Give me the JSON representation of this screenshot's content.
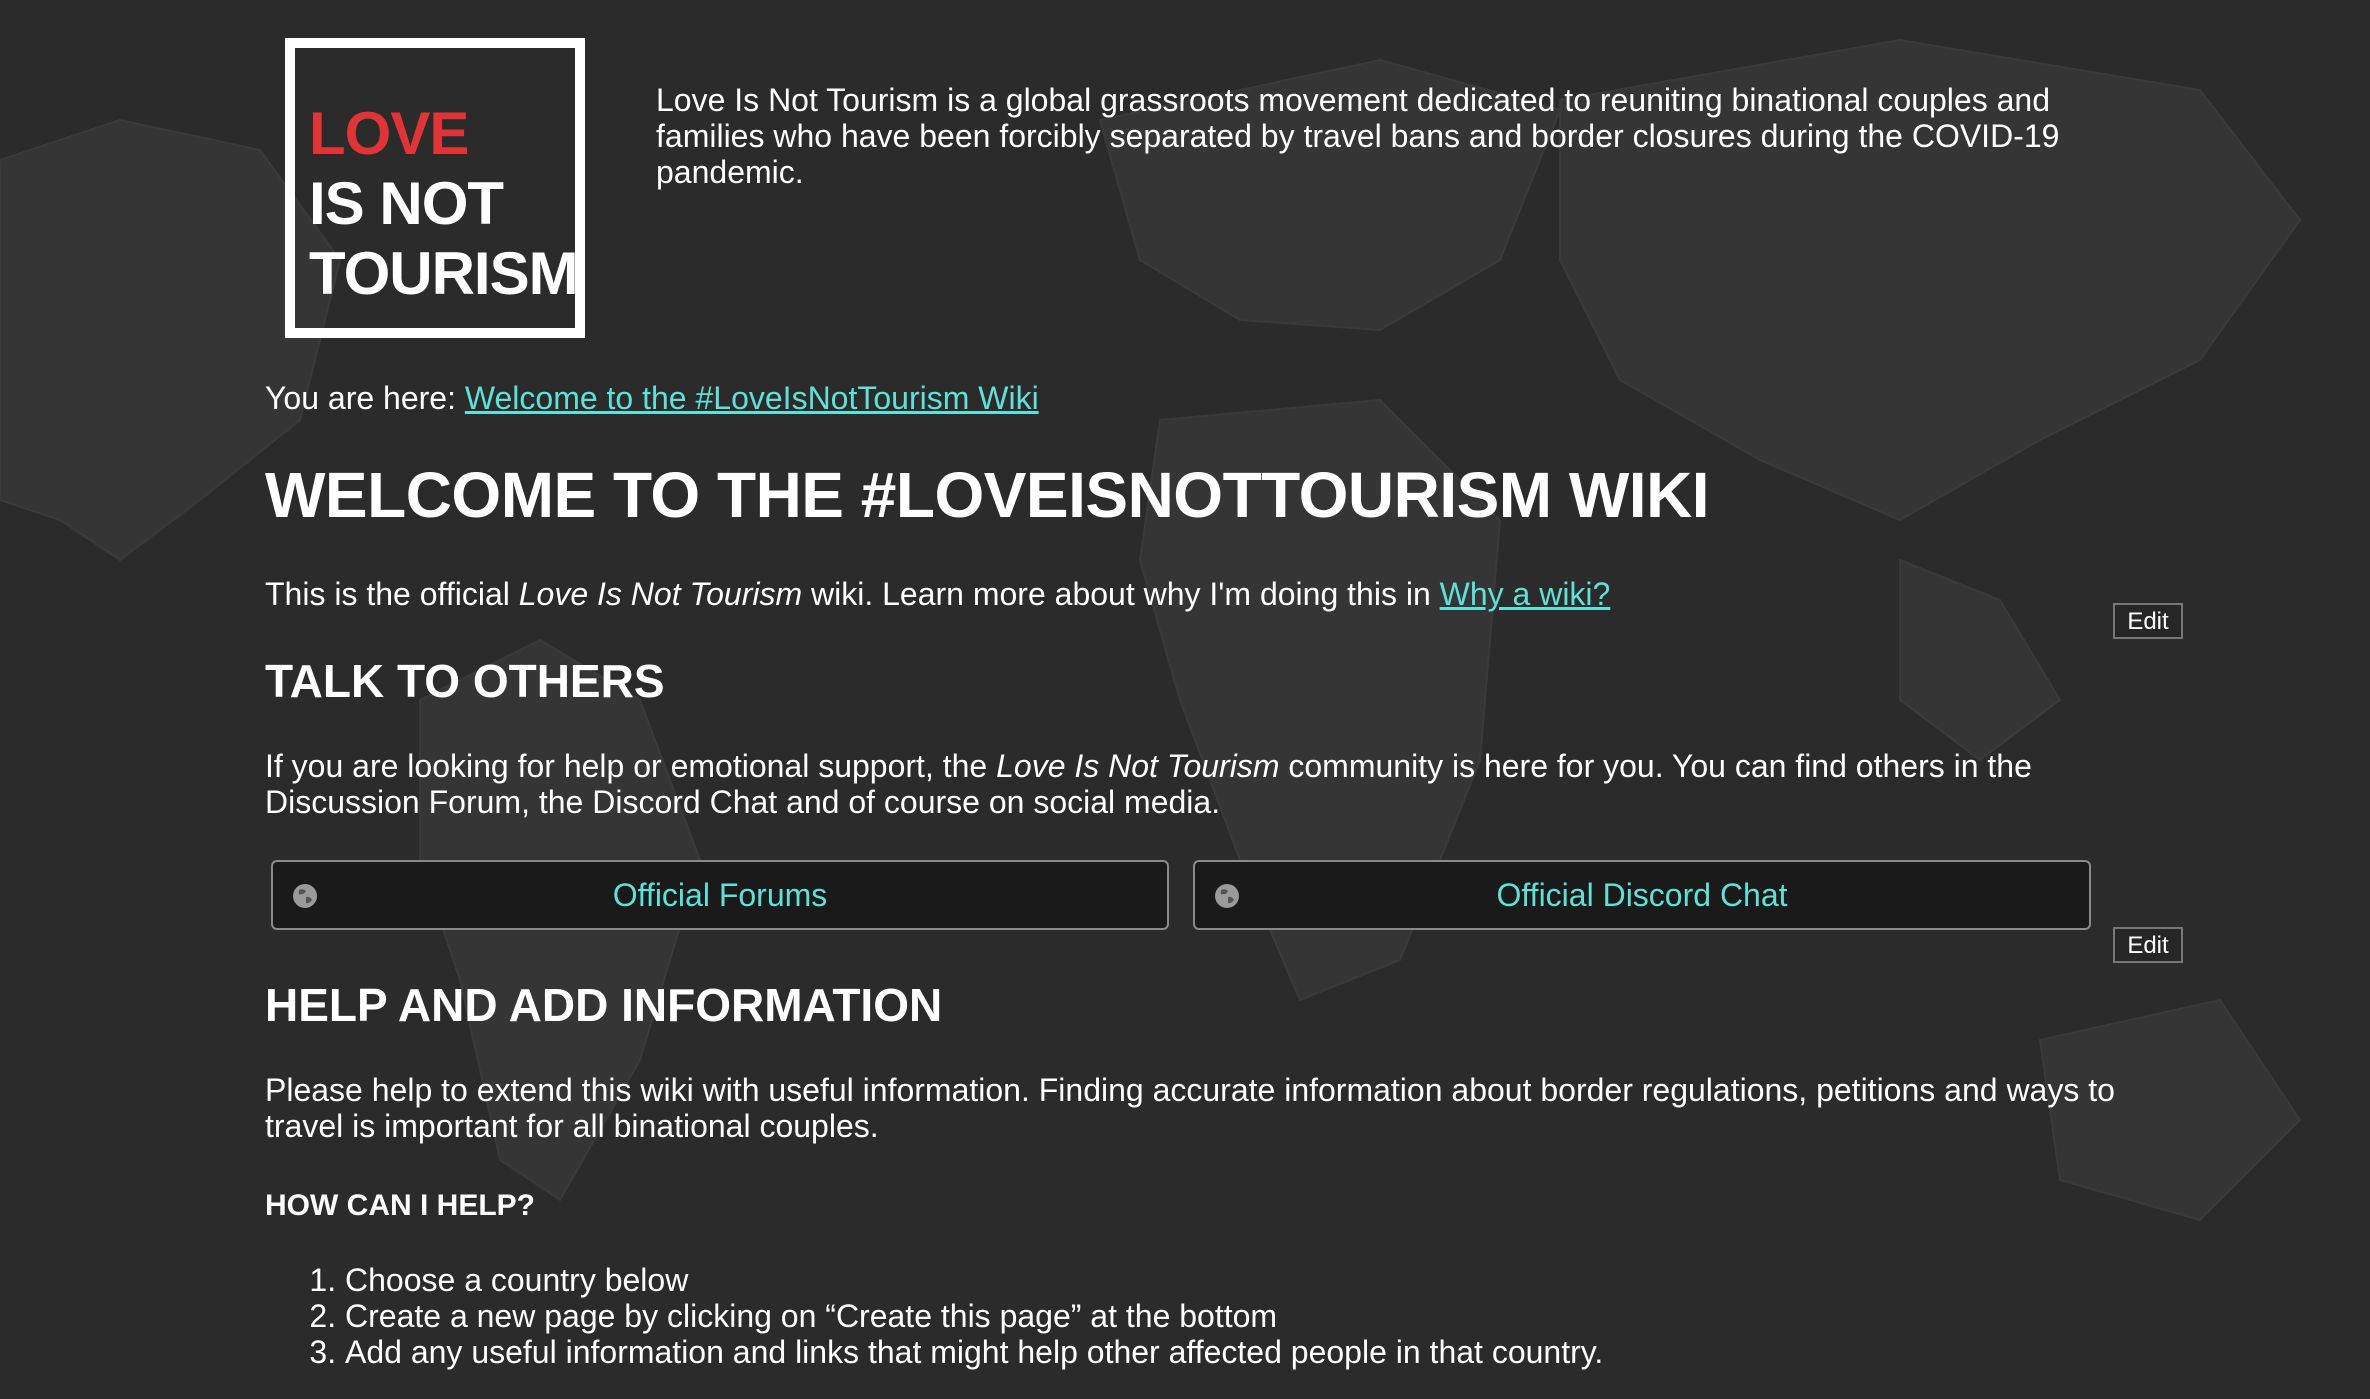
{
  "logo": {
    "line1": "LOVE",
    "line2": "IS NOT",
    "line3": "TOURISM"
  },
  "tagline": "Love Is Not Tourism is a global grassroots movement dedicated to reuniting binational couples and families who have been forcibly separated by travel bans and border closures during the COVID-19 pandemic.",
  "breadcrumb": {
    "prefix": "You are here:",
    "link": "Welcome to the #LoveIsNotTourism Wiki"
  },
  "title": "WELCOME TO THE #LOVEISNOTTOURISM WIKI",
  "intro": {
    "before": "This is the official ",
    "emphasis": "Love Is Not Tourism",
    "after": " wiki. Learn more about why I'm doing this in ",
    "link": "Why a wiki?"
  },
  "edit_label": "Edit",
  "talk": {
    "heading": "TALK TO OTHERS",
    "before": "If you are looking for help or emotional support, the ",
    "emphasis": "Love Is Not Tourism",
    "after": " community is here for you. You can find others in the Discussion Forum, the Discord Chat and of course on social media.",
    "buttons": [
      {
        "label": "Official Forums",
        "icon": "globe-icon"
      },
      {
        "label": "Official Discord Chat",
        "icon": "globe-icon"
      }
    ]
  },
  "help": {
    "heading": "HELP AND ADD INFORMATION",
    "text": "Please help to extend this wiki with useful information. Finding accurate information about border regulations, petitions and ways to travel is important for all binational couples.",
    "subheading": "HOW CAN I HELP?",
    "steps": [
      "Choose a country below",
      "Create a new page by clicking on “Create this page” at the bottom",
      "Add any useful information and links that might help other affected people in that country."
    ]
  },
  "colors": {
    "background": "#2b2b2b",
    "accent_red": "#e03436",
    "link": "#5fe0d8"
  }
}
